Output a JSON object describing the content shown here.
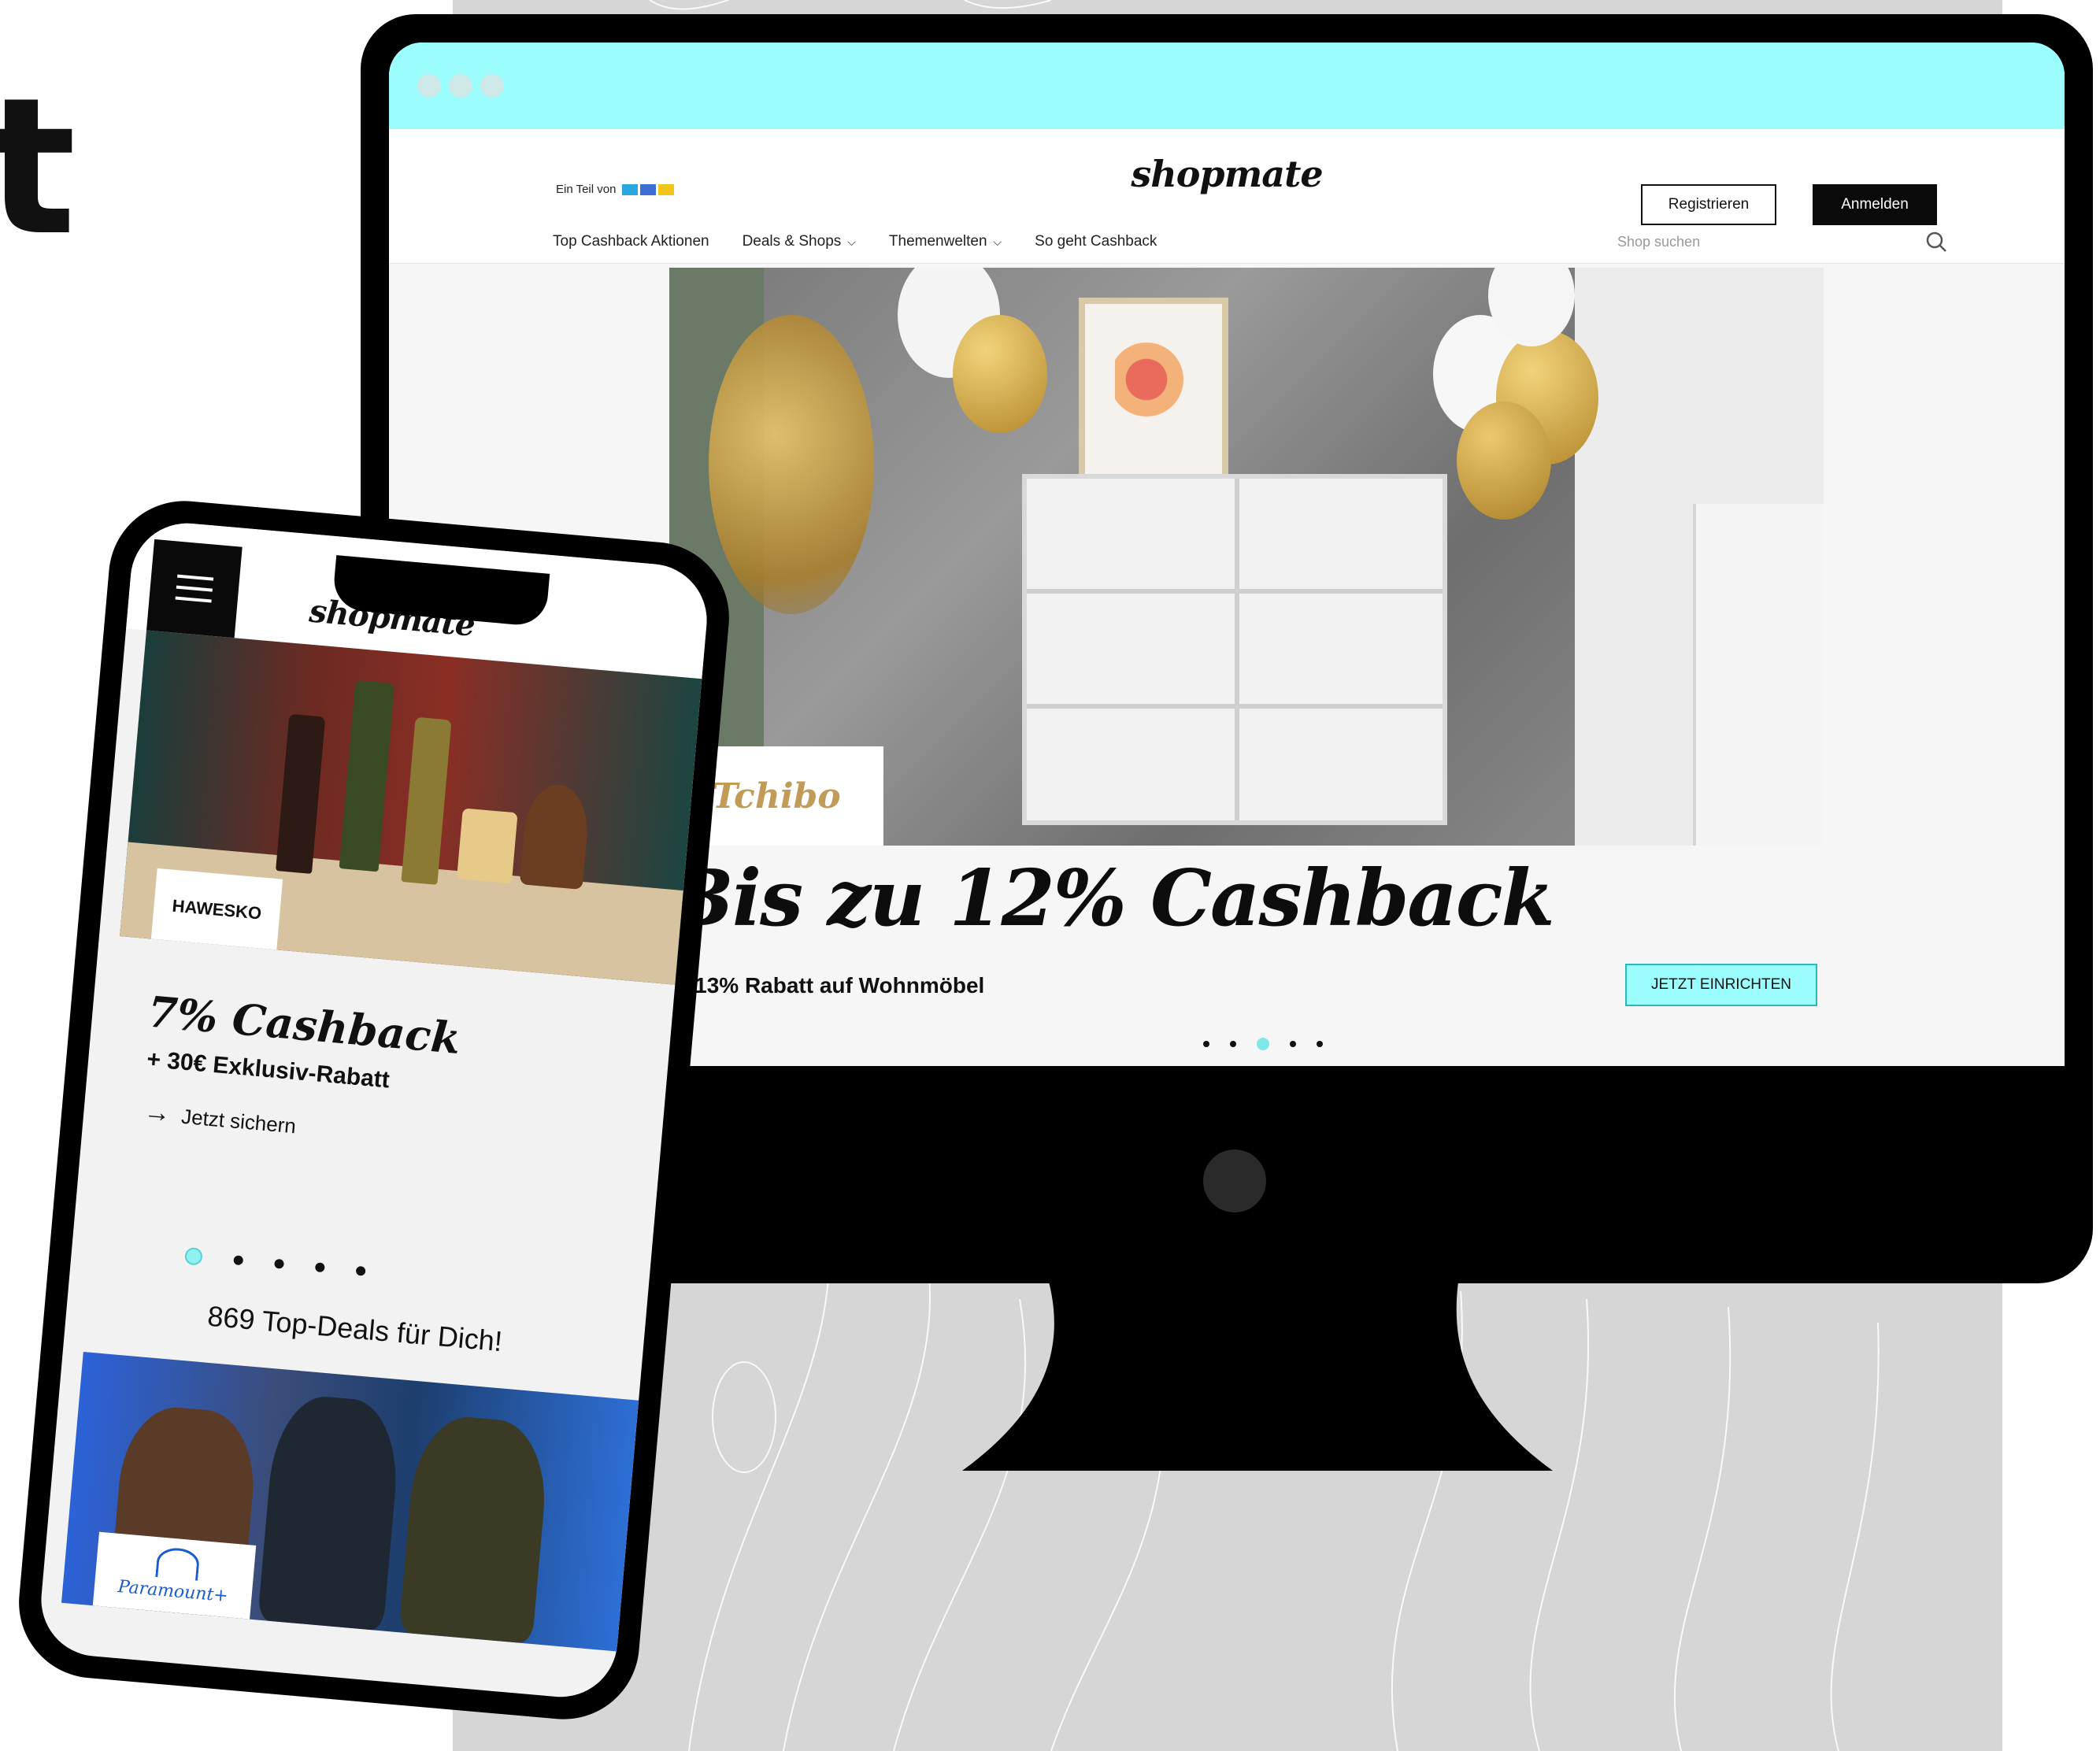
{
  "page": {
    "partial_heading": "t"
  },
  "desktop": {
    "partner_tag": {
      "prefix": "Ein Teil von",
      "brand": "RTL"
    },
    "logo": "shopmate",
    "buttons": {
      "register": "Registrieren",
      "login": "Anmelden"
    },
    "nav": [
      {
        "label": "Top Cashback Aktionen",
        "dropdown": false
      },
      {
        "label": "Deals & Shops",
        "dropdown": true
      },
      {
        "label": "Themenwelten",
        "dropdown": true
      },
      {
        "label": "So geht Cashback",
        "dropdown": false
      }
    ],
    "search": {
      "placeholder": "Shop suchen"
    },
    "hero": {
      "shop_logo": "Tchibo",
      "title": "Bis zu 12% Cashback",
      "subtitle": "+ 13% Rabatt auf Wohnmöbel",
      "cta": "JETZT EINRICHTEN",
      "carousel": {
        "count": 5,
        "active_index": 2
      }
    }
  },
  "mobile": {
    "logo": "shopmate",
    "hero": {
      "shop_logo": "HAWESKO",
      "title": "7% Cashback",
      "subtitle": "+ 30€ Exklusiv-Rabatt",
      "link": "Jetzt sichern",
      "carousel": {
        "count": 5,
        "active_index": 0
      }
    },
    "deals_heading": "869 Top-Deals für Dich!",
    "promo": {
      "shop_logo": "Paramount+"
    }
  },
  "colors": {
    "accent": "#9bfdfc",
    "background_panel": "#d6d6d6",
    "device": "#000000",
    "text": "#111111"
  },
  "icons": [
    "search-icon",
    "chevron-down-icon",
    "menu-icon",
    "arrow-right-icon"
  ]
}
